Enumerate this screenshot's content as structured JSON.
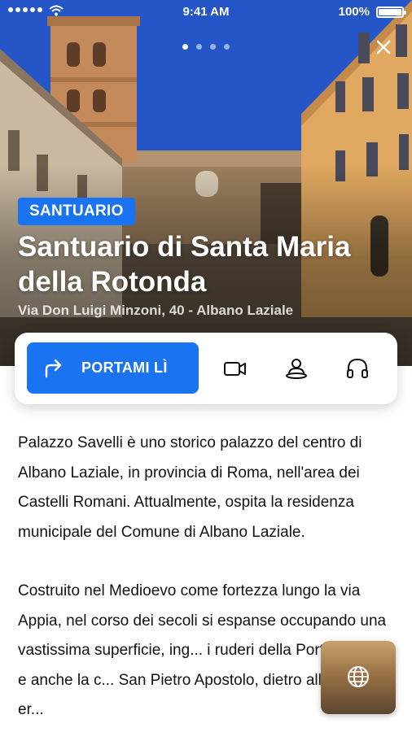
{
  "status_bar": {
    "time": "9:41 AM",
    "battery": "100%"
  },
  "gallery": {
    "total": 4,
    "active": 0
  },
  "hero": {
    "category": "SANTUARIO",
    "title": "Santuario di Santa Maria della Rotonda",
    "address": "Via Don Luigi Minzoni, 40 - Albano Laziale"
  },
  "actions": {
    "primary_label": "PORTAMI LÌ",
    "icons": [
      "video-icon",
      "guide-person-icon",
      "headphones-icon"
    ]
  },
  "content": {
    "paragraphs": [
      "Palazzo Savelli è uno storico palazzo del centro di Albano Laziale, in provincia di Roma, nell'area dei Castelli Romani. Attualmente, ospita la residenza municipale del Comune di Albano Laziale.",
      "Costruito nel Medioevo come fortezza lungo la via Appia, nel corso dei secoli si espanse occupando una vastissima superficie, ing... i ruderi della Porta Pretoria e anche la c... San Pietro Apostolo, dietro alla quale er..."
    ]
  },
  "colors": {
    "accent": "#1a73f0",
    "text": "#111111"
  }
}
